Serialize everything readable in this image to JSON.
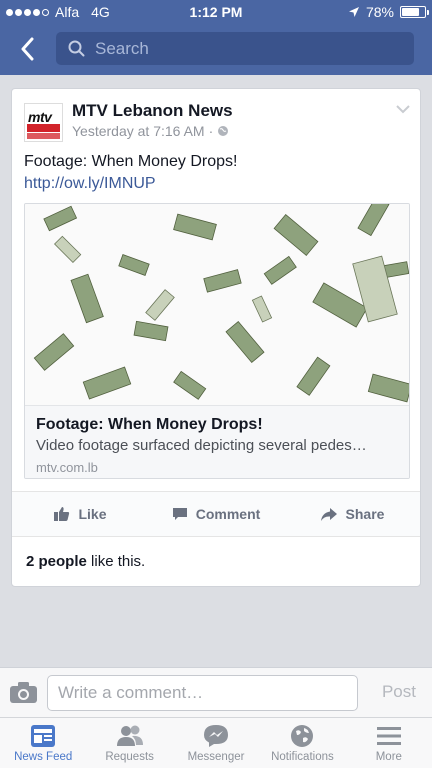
{
  "status_bar": {
    "carrier": "Alfa",
    "network": "4G",
    "time": "1:12 PM",
    "battery_text": "78%",
    "battery_level": 0.78,
    "signal_bars_filled": 4
  },
  "nav": {
    "search_placeholder": "Search"
  },
  "post": {
    "page_name": "MTV Lebanon News",
    "timestamp": "Yesterday at 7:16 AM",
    "separator": "·",
    "logo_text": "mtv",
    "text": "Footage: When Money Drops!",
    "link": "http://ow.ly/IMNUP",
    "attachment": {
      "title": "Footage: When Money Drops!",
      "description": "Video footage surfaced depicting several pedes…",
      "domain": "mtv.com.lb"
    },
    "actions": {
      "like": "Like",
      "comment": "Comment",
      "share": "Share"
    },
    "likes_count": "2 people",
    "likes_suffix": " like this."
  },
  "comment_bar": {
    "placeholder": "Write a comment…",
    "post_label": "Post"
  },
  "tabs": [
    {
      "label": "News Feed",
      "icon": "news-feed-icon",
      "active": true
    },
    {
      "label": "Requests",
      "icon": "requests-icon",
      "active": false
    },
    {
      "label": "Messenger",
      "icon": "messenger-icon",
      "active": false
    },
    {
      "label": "Notifications",
      "icon": "notifications-icon",
      "active": false
    },
    {
      "label": "More",
      "icon": "more-icon",
      "active": false
    }
  ],
  "colors": {
    "header": "#4a66a3",
    "link": "#3b5998",
    "active_tab": "#4a78c9"
  }
}
